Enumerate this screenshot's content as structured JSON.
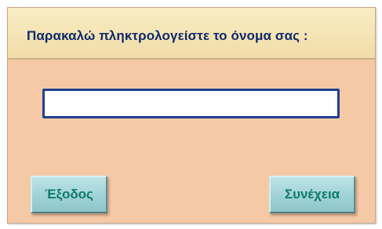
{
  "dialog": {
    "prompt": "Παρακαλώ πληκτρολογείστε το όνομα σας :",
    "name_input": {
      "value": "",
      "placeholder": ""
    },
    "buttons": {
      "exit_label": "Έξοδος",
      "continue_label": "Συνέχεια"
    }
  }
}
